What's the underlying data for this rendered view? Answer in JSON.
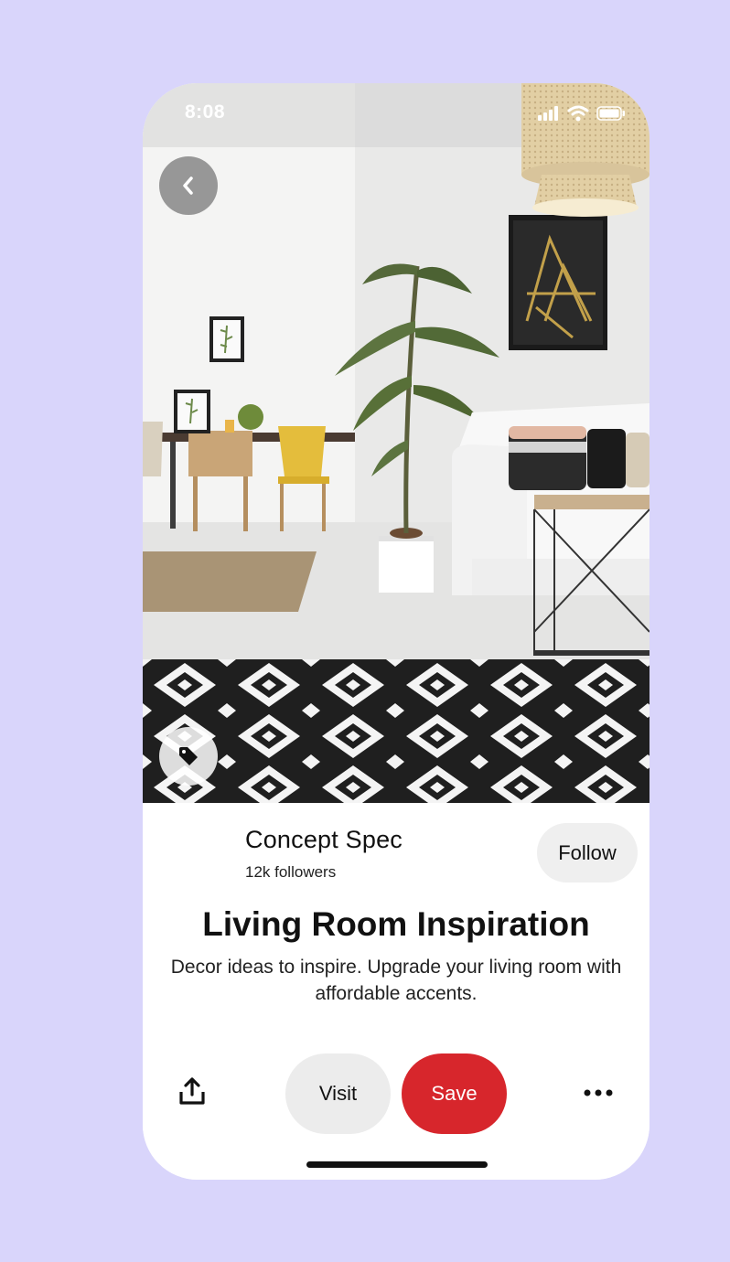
{
  "status_bar": {
    "time": "8:08",
    "icons": [
      "signal-icon",
      "wifi-icon",
      "battery-icon"
    ]
  },
  "hero": {
    "icons": [
      "back-arrow-icon",
      "tag-icon"
    ]
  },
  "creator": {
    "name": "Concept Spec",
    "followers": "12k followers",
    "follow_label": "Follow"
  },
  "pin": {
    "title": "Living Room Inspiration",
    "description": "Decor ideas to inspire. Upgrade your living room with affordable accents."
  },
  "actions": {
    "share_icon": "share-icon",
    "visit_label": "Visit",
    "save_label": "Save",
    "more_icon": "more-icon"
  },
  "colors": {
    "background": "#d9d5fb",
    "save_button": "#d7262c",
    "visit_button": "#ececec",
    "follow_button": "#efefef"
  }
}
